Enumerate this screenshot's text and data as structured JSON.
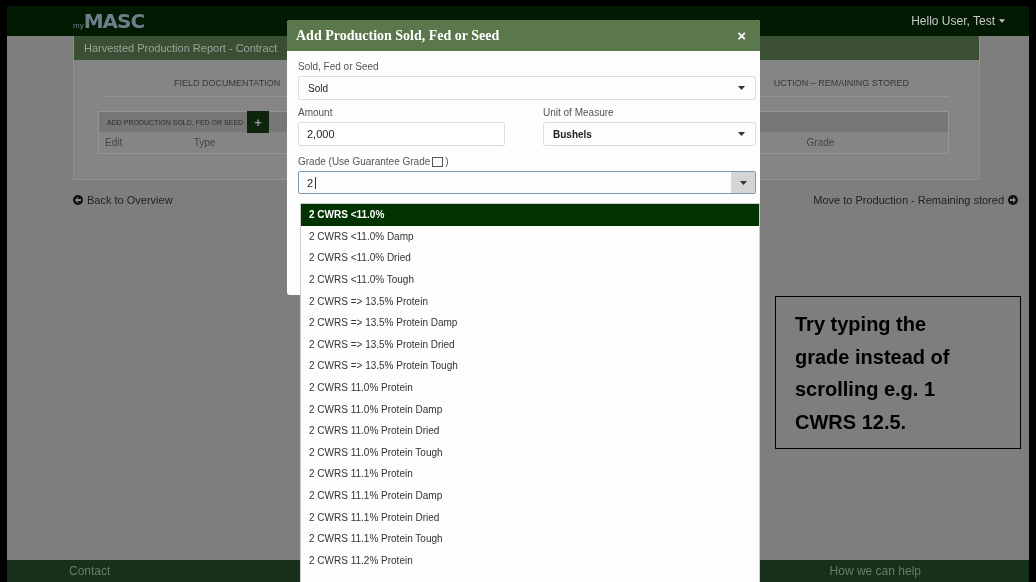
{
  "navbar": {
    "logo_prefix": "my",
    "logo": "MASC",
    "user_menu": "Hello User, Test"
  },
  "page": {
    "header": "Harvested Production Report - Contract",
    "tabs": [
      "FIELD DOCUMENTATION",
      "UCTION – REMAINING STORED"
    ],
    "table": {
      "add_label": "ADD PRODUCTION SOLD, FED OR SEED",
      "add_button": "+",
      "columns": [
        "Edit",
        "Type",
        "Grade"
      ]
    },
    "back_link": "Back to Overview",
    "next_link": "Move to Production - Remaining stored"
  },
  "footer": [
    "Contact",
    "How we can help"
  ],
  "modal": {
    "title": "Add Production Sold, Fed or Seed",
    "close": "×",
    "use_field": {
      "label": "Sold, Fed or Seed",
      "value": "Sold"
    },
    "amount": {
      "label": "Amount",
      "value": "2,000"
    },
    "unit": {
      "label": "Unit of Measure",
      "value": "Bushels"
    },
    "grade": {
      "label_before": "Grade (Use Guarantee Grade",
      "label_after": ")",
      "guarantee_checked": false,
      "value": "2"
    }
  },
  "dropdown": [
    {
      "label": "2 CWRS <11.0%",
      "selected": true
    },
    {
      "label": "2 CWRS <11.0% Damp",
      "selected": false
    },
    {
      "label": "2 CWRS <11.0% Dried",
      "selected": false
    },
    {
      "label": "2 CWRS <11.0% Tough",
      "selected": false
    },
    {
      "label": "2 CWRS => 13.5% Protein",
      "selected": false
    },
    {
      "label": "2 CWRS => 13.5% Protein Damp",
      "selected": false
    },
    {
      "label": "2 CWRS => 13.5% Protein Dried",
      "selected": false
    },
    {
      "label": "2 CWRS => 13.5% Protein Tough",
      "selected": false
    },
    {
      "label": "2 CWRS 11.0% Protein",
      "selected": false
    },
    {
      "label": "2 CWRS 11.0% Protein Damp",
      "selected": false
    },
    {
      "label": "2 CWRS 11.0% Protein Dried",
      "selected": false
    },
    {
      "label": "2 CWRS 11.0% Protein Tough",
      "selected": false
    },
    {
      "label": "2 CWRS 11.1% Protein",
      "selected": false
    },
    {
      "label": "2 CWRS 11.1% Protein Damp",
      "selected": false
    },
    {
      "label": "2 CWRS 11.1% Protein Dried",
      "selected": false
    },
    {
      "label": "2 CWRS 11.1% Protein Tough",
      "selected": false
    },
    {
      "label": "2 CWRS 11.2% Protein",
      "selected": false
    }
  ],
  "tip": "Try typing the grade instead of scrolling e.g. 1 CWRS 12.5."
}
